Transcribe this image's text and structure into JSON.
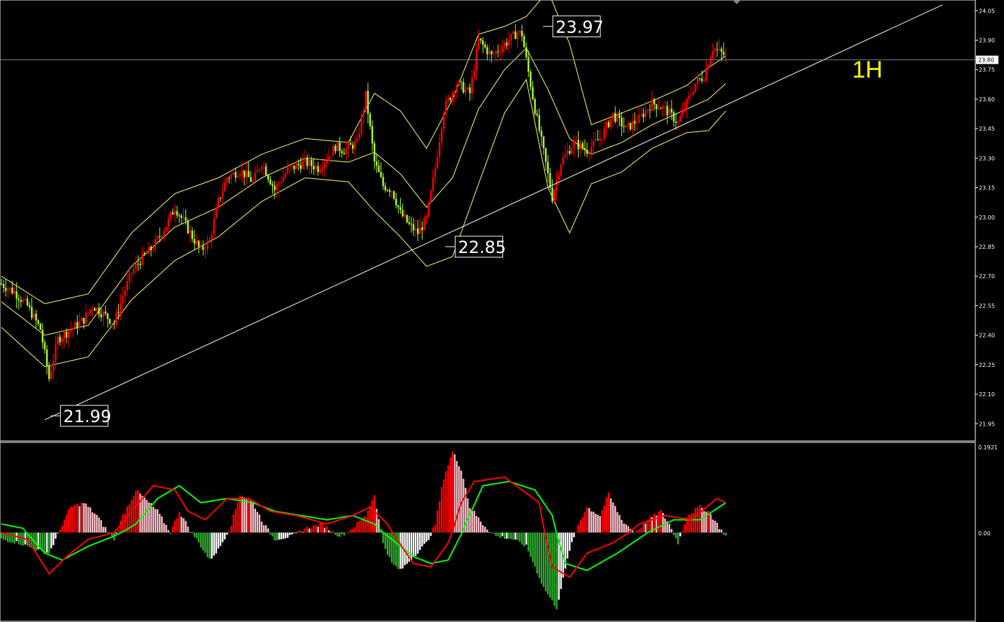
{
  "timeframe_label": "1H",
  "colors": {
    "background": "#000000",
    "candle_up": "#ff0000",
    "candle_down": "#adff2f",
    "bollinger": "#ffff66",
    "trendline": "#ffffff",
    "gridline": "#708090",
    "macd_pos_rising": "#ff0000",
    "macd_pos_falling": "#ffc0cb",
    "macd_neg_falling": "#2eaa2e",
    "macd_neg_rising": "#ffffff",
    "signal_fast": "#ff0000",
    "signal_slow": "#00ff00",
    "timeframe_label": "#ffff00"
  },
  "price_labels": [
    {
      "text": "21.99",
      "price": 21.99
    },
    {
      "text": "22.85",
      "price": 22.85
    },
    {
      "text": "23.97",
      "price": 23.97
    }
  ],
  "chart_data": [
    {
      "type": "candlestick",
      "title": "",
      "current_price_line": 23.8,
      "current_price_text": "23.80",
      "ylim": [
        21.88,
        24.09
      ],
      "yticks": [
        "24.05",
        "23.90",
        "23.75",
        "23.60",
        "23.45",
        "23.30",
        "23.15",
        "23.00",
        "22.85",
        "22.70",
        "22.55",
        "22.40",
        "22.25",
        "22.10",
        "21.95"
      ],
      "close_anchors": [
        [
          0,
          22.66
        ],
        [
          6,
          22.62
        ],
        [
          12,
          22.55
        ],
        [
          18,
          22.43
        ],
        [
          22,
          22.18
        ],
        [
          26,
          22.38
        ],
        [
          32,
          22.43
        ],
        [
          38,
          22.48
        ],
        [
          42,
          22.55
        ],
        [
          48,
          22.5
        ],
        [
          52,
          22.46
        ],
        [
          56,
          22.6
        ],
        [
          60,
          22.72
        ],
        [
          64,
          22.78
        ],
        [
          70,
          22.85
        ],
        [
          76,
          22.96
        ],
        [
          80,
          23.05
        ],
        [
          84,
          22.98
        ],
        [
          88,
          22.9
        ],
        [
          92,
          22.83
        ],
        [
          96,
          22.88
        ],
        [
          100,
          23.08
        ],
        [
          104,
          23.2
        ],
        [
          110,
          23.24
        ],
        [
          116,
          23.18
        ],
        [
          120,
          23.28
        ],
        [
          126,
          23.14
        ],
        [
          132,
          23.24
        ],
        [
          140,
          23.28
        ],
        [
          146,
          23.25
        ],
        [
          150,
          23.3
        ],
        [
          154,
          23.36
        ],
        [
          158,
          23.34
        ],
        [
          164,
          23.38
        ],
        [
          168,
          23.62
        ],
        [
          172,
          23.28
        ],
        [
          176,
          23.16
        ],
        [
          180,
          23.14
        ],
        [
          184,
          23.02
        ],
        [
          188,
          22.96
        ],
        [
          192,
          22.92
        ],
        [
          196,
          22.99
        ],
        [
          200,
          23.25
        ],
        [
          204,
          23.55
        ],
        [
          210,
          23.68
        ],
        [
          216,
          23.63
        ],
        [
          220,
          23.9
        ],
        [
          226,
          23.82
        ],
        [
          232,
          23.88
        ],
        [
          238,
          23.94
        ],
        [
          240,
          23.93
        ],
        [
          242,
          23.8
        ],
        [
          246,
          23.55
        ],
        [
          250,
          23.33
        ],
        [
          254,
          23.1
        ],
        [
          258,
          23.28
        ],
        [
          264,
          23.38
        ],
        [
          270,
          23.34
        ],
        [
          276,
          23.4
        ],
        [
          282,
          23.52
        ],
        [
          288,
          23.45
        ],
        [
          294,
          23.5
        ],
        [
          300,
          23.58
        ],
        [
          306,
          23.55
        ],
        [
          312,
          23.48
        ],
        [
          316,
          23.58
        ],
        [
          320,
          23.68
        ],
        [
          324,
          23.72
        ],
        [
          328,
          23.86
        ],
        [
          334,
          23.82
        ]
      ],
      "bollinger_mid_anchors": [
        [
          0,
          22.57
        ],
        [
          20,
          22.4
        ],
        [
          40,
          22.45
        ],
        [
          60,
          22.75
        ],
        [
          80,
          22.95
        ],
        [
          100,
          23.05
        ],
        [
          120,
          23.2
        ],
        [
          140,
          23.3
        ],
        [
          160,
          23.28
        ],
        [
          172,
          23.33
        ],
        [
          184,
          23.22
        ],
        [
          196,
          23.05
        ],
        [
          208,
          23.2
        ],
        [
          220,
          23.55
        ],
        [
          232,
          23.75
        ],
        [
          242,
          23.86
        ],
        [
          252,
          23.65
        ],
        [
          262,
          23.4
        ],
        [
          272,
          23.32
        ],
        [
          286,
          23.38
        ],
        [
          300,
          23.47
        ],
        [
          316,
          23.55
        ],
        [
          326,
          23.6
        ],
        [
          334,
          23.68
        ]
      ],
      "bollinger_width_anchors": [
        [
          0,
          0.13
        ],
        [
          20,
          0.16
        ],
        [
          40,
          0.16
        ],
        [
          60,
          0.17
        ],
        [
          80,
          0.17
        ],
        [
          100,
          0.15
        ],
        [
          120,
          0.12
        ],
        [
          140,
          0.1
        ],
        [
          160,
          0.1
        ],
        [
          172,
          0.3
        ],
        [
          184,
          0.32
        ],
        [
          196,
          0.3
        ],
        [
          208,
          0.4
        ],
        [
          220,
          0.38
        ],
        [
          232,
          0.22
        ],
        [
          242,
          0.16
        ],
        [
          252,
          0.5
        ],
        [
          262,
          0.48
        ],
        [
          272,
          0.15
        ],
        [
          286,
          0.15
        ],
        [
          300,
          0.12
        ],
        [
          316,
          0.12
        ],
        [
          326,
          0.16
        ],
        [
          334,
          0.14
        ]
      ],
      "trendline": {
        "from": [
          20,
          21.97
        ],
        "to": [
          434,
          24.08
        ]
      },
      "n_bars": 335
    },
    {
      "type": "histogram",
      "title": "",
      "max_label": "0.1921",
      "zero_label": "0.00",
      "ylim": [
        -0.25,
        0.1921
      ],
      "hist_anchors": [
        [
          0,
          -0.02
        ],
        [
          8,
          -0.03
        ],
        [
          16,
          -0.05
        ],
        [
          22,
          -0.06
        ],
        [
          28,
          0.02
        ],
        [
          32,
          0.06
        ],
        [
          38,
          0.07
        ],
        [
          44,
          0.04
        ],
        [
          48,
          0.01
        ],
        [
          52,
          -0.02
        ],
        [
          56,
          0.04
        ],
        [
          62,
          0.1
        ],
        [
          66,
          0.08
        ],
        [
          72,
          0.05
        ],
        [
          78,
          0.0
        ],
        [
          82,
          0.05
        ],
        [
          90,
          -0.02
        ],
        [
          96,
          -0.08
        ],
        [
          100,
          -0.05
        ],
        [
          106,
          0.02
        ],
        [
          110,
          0.09
        ],
        [
          116,
          0.07
        ],
        [
          120,
          0.03
        ],
        [
          126,
          -0.02
        ],
        [
          134,
          -0.01
        ],
        [
          140,
          0.01
        ],
        [
          148,
          0.02
        ],
        [
          156,
          -0.01
        ],
        [
          162,
          0.01
        ],
        [
          168,
          0.04
        ],
        [
          172,
          0.09
        ],
        [
          176,
          -0.03
        ],
        [
          180,
          -0.09
        ],
        [
          184,
          -0.11
        ],
        [
          190,
          -0.07
        ],
        [
          196,
          -0.03
        ],
        [
          200,
          0.02
        ],
        [
          204,
          0.13
        ],
        [
          208,
          0.19
        ],
        [
          212,
          0.15
        ],
        [
          216,
          0.06
        ],
        [
          222,
          0.02
        ],
        [
          228,
          -0.01
        ],
        [
          236,
          -0.02
        ],
        [
          242,
          -0.04
        ],
        [
          250,
          -0.16
        ],
        [
          256,
          -0.22
        ],
        [
          262,
          -0.05
        ],
        [
          266,
          0.02
        ],
        [
          270,
          0.06
        ],
        [
          276,
          0.04
        ],
        [
          280,
          0.09
        ],
        [
          286,
          0.03
        ],
        [
          292,
          0.0
        ],
        [
          298,
          0.03
        ],
        [
          304,
          0.05
        ],
        [
          308,
          0.02
        ],
        [
          312,
          -0.03
        ],
        [
          316,
          0.04
        ],
        [
          322,
          0.06
        ],
        [
          326,
          0.05
        ],
        [
          334,
          -0.01
        ]
      ],
      "line_fast_anchors": [
        [
          0,
          0.0
        ],
        [
          12,
          -0.02
        ],
        [
          22,
          -0.12
        ],
        [
          30,
          -0.07
        ],
        [
          40,
          -0.02
        ],
        [
          52,
          0.0
        ],
        [
          60,
          0.05
        ],
        [
          70,
          0.11
        ],
        [
          80,
          0.1
        ],
        [
          86,
          0.05
        ],
        [
          94,
          0.03
        ],
        [
          104,
          0.08
        ],
        [
          114,
          0.08
        ],
        [
          124,
          0.05
        ],
        [
          136,
          0.04
        ],
        [
          150,
          0.02
        ],
        [
          162,
          0.04
        ],
        [
          170,
          0.06
        ],
        [
          178,
          0.02
        ],
        [
          190,
          -0.09
        ],
        [
          198,
          -0.1
        ],
        [
          206,
          -0.03
        ],
        [
          212,
          0.07
        ],
        [
          218,
          0.12
        ],
        [
          232,
          0.13
        ],
        [
          240,
          0.1
        ],
        [
          248,
          0.07
        ],
        [
          254,
          -0.1
        ],
        [
          262,
          -0.13
        ],
        [
          270,
          -0.06
        ],
        [
          282,
          -0.03
        ],
        [
          294,
          0.02
        ],
        [
          306,
          0.04
        ],
        [
          318,
          0.03
        ],
        [
          330,
          0.08
        ],
        [
          334,
          0.07
        ]
      ],
      "line_slow_anchors": [
        [
          0,
          0.02
        ],
        [
          10,
          0.01
        ],
        [
          20,
          -0.06
        ],
        [
          28,
          -0.08
        ],
        [
          40,
          -0.04
        ],
        [
          52,
          -0.01
        ],
        [
          62,
          0.02
        ],
        [
          72,
          0.08
        ],
        [
          82,
          0.11
        ],
        [
          92,
          0.07
        ],
        [
          104,
          0.08
        ],
        [
          116,
          0.07
        ],
        [
          126,
          0.05
        ],
        [
          138,
          0.04
        ],
        [
          150,
          0.03
        ],
        [
          162,
          0.04
        ],
        [
          172,
          0.02
        ],
        [
          182,
          -0.03
        ],
        [
          190,
          -0.07
        ],
        [
          198,
          -0.09
        ],
        [
          206,
          -0.08
        ],
        [
          214,
          0.02
        ],
        [
          222,
          0.11
        ],
        [
          234,
          0.12
        ],
        [
          246,
          0.1
        ],
        [
          254,
          0.04
        ],
        [
          260,
          -0.09
        ],
        [
          270,
          -0.11
        ],
        [
          284,
          -0.06
        ],
        [
          298,
          0.0
        ],
        [
          310,
          0.03
        ],
        [
          322,
          0.03
        ],
        [
          334,
          0.07
        ]
      ]
    }
  ]
}
